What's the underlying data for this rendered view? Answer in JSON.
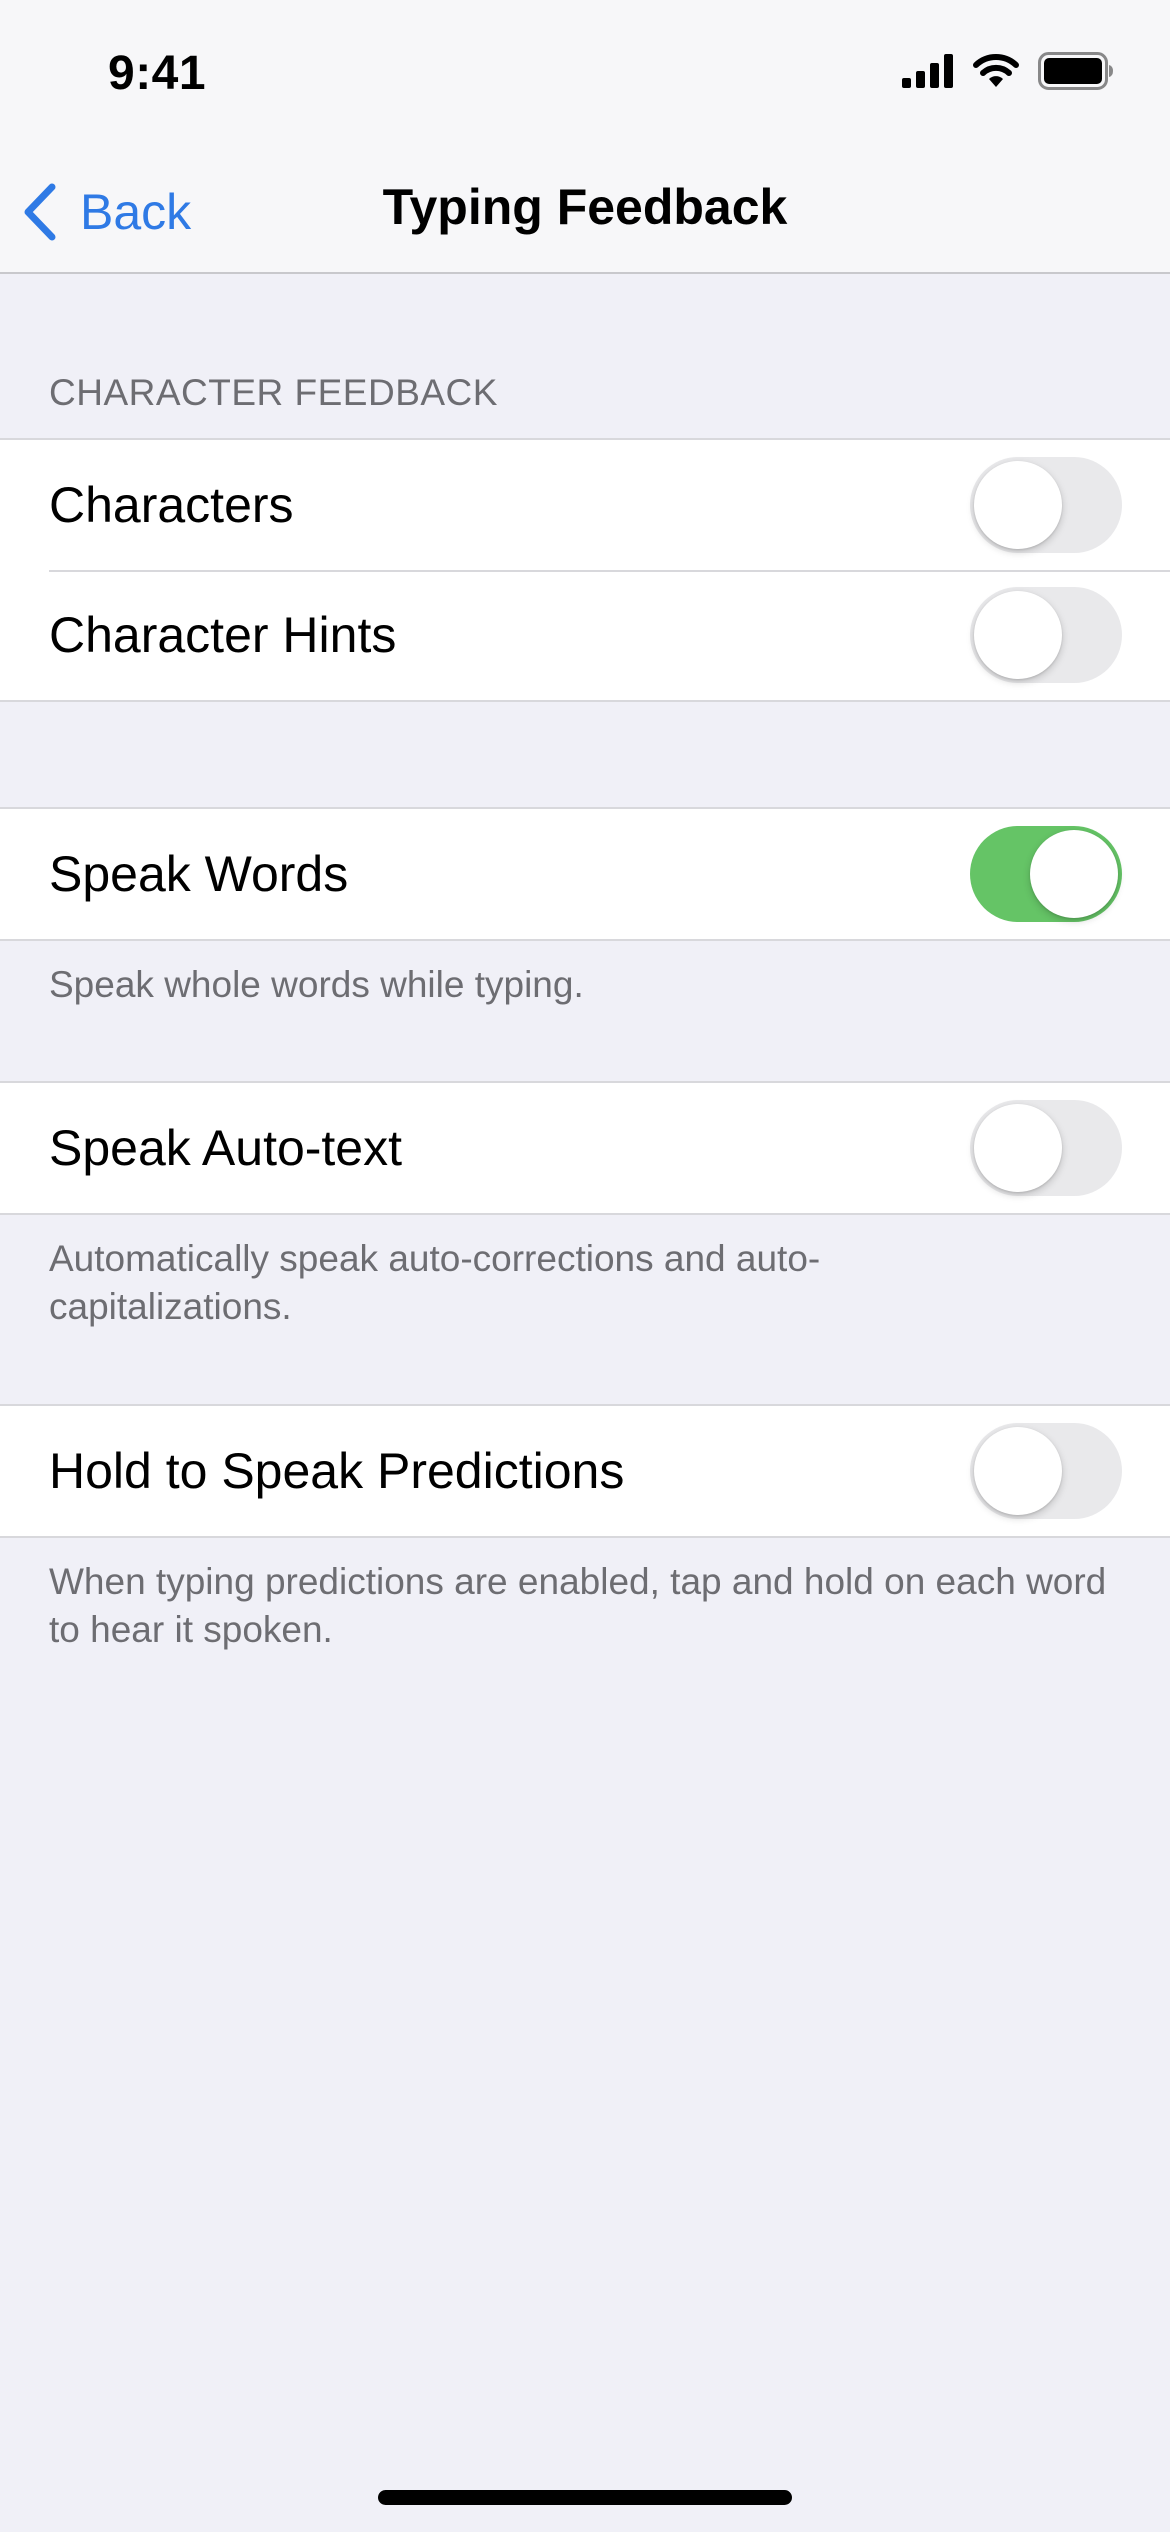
{
  "status_bar": {
    "time": "9:41",
    "icons": [
      "cellular-signal-icon",
      "wifi-icon",
      "battery-icon"
    ]
  },
  "nav": {
    "back_label": "Back",
    "title": "Typing Feedback"
  },
  "section_header": "CHARACTER FEEDBACK",
  "groups": [
    {
      "rows": [
        {
          "label": "Characters",
          "on": false
        },
        {
          "label": "Character Hints",
          "on": false
        }
      ]
    },
    {
      "rows": [
        {
          "label": "Speak Words",
          "on": true
        }
      ],
      "footer": "Speak whole words while typing."
    },
    {
      "rows": [
        {
          "label": "Speak Auto-text",
          "on": false
        }
      ],
      "footer": "Automatically speak auto-corrections and auto-capitalizations."
    },
    {
      "rows": [
        {
          "label": "Hold to Speak Predictions",
          "on": false
        }
      ],
      "footer": "When typing predictions are enabled, tap and hold on each word to hear it spoken."
    }
  ],
  "colors": {
    "accent": "#2f7ae5",
    "toggle_on": "#65c466",
    "toggle_off": "#e9e9eb",
    "background": "#f0f0f7"
  }
}
